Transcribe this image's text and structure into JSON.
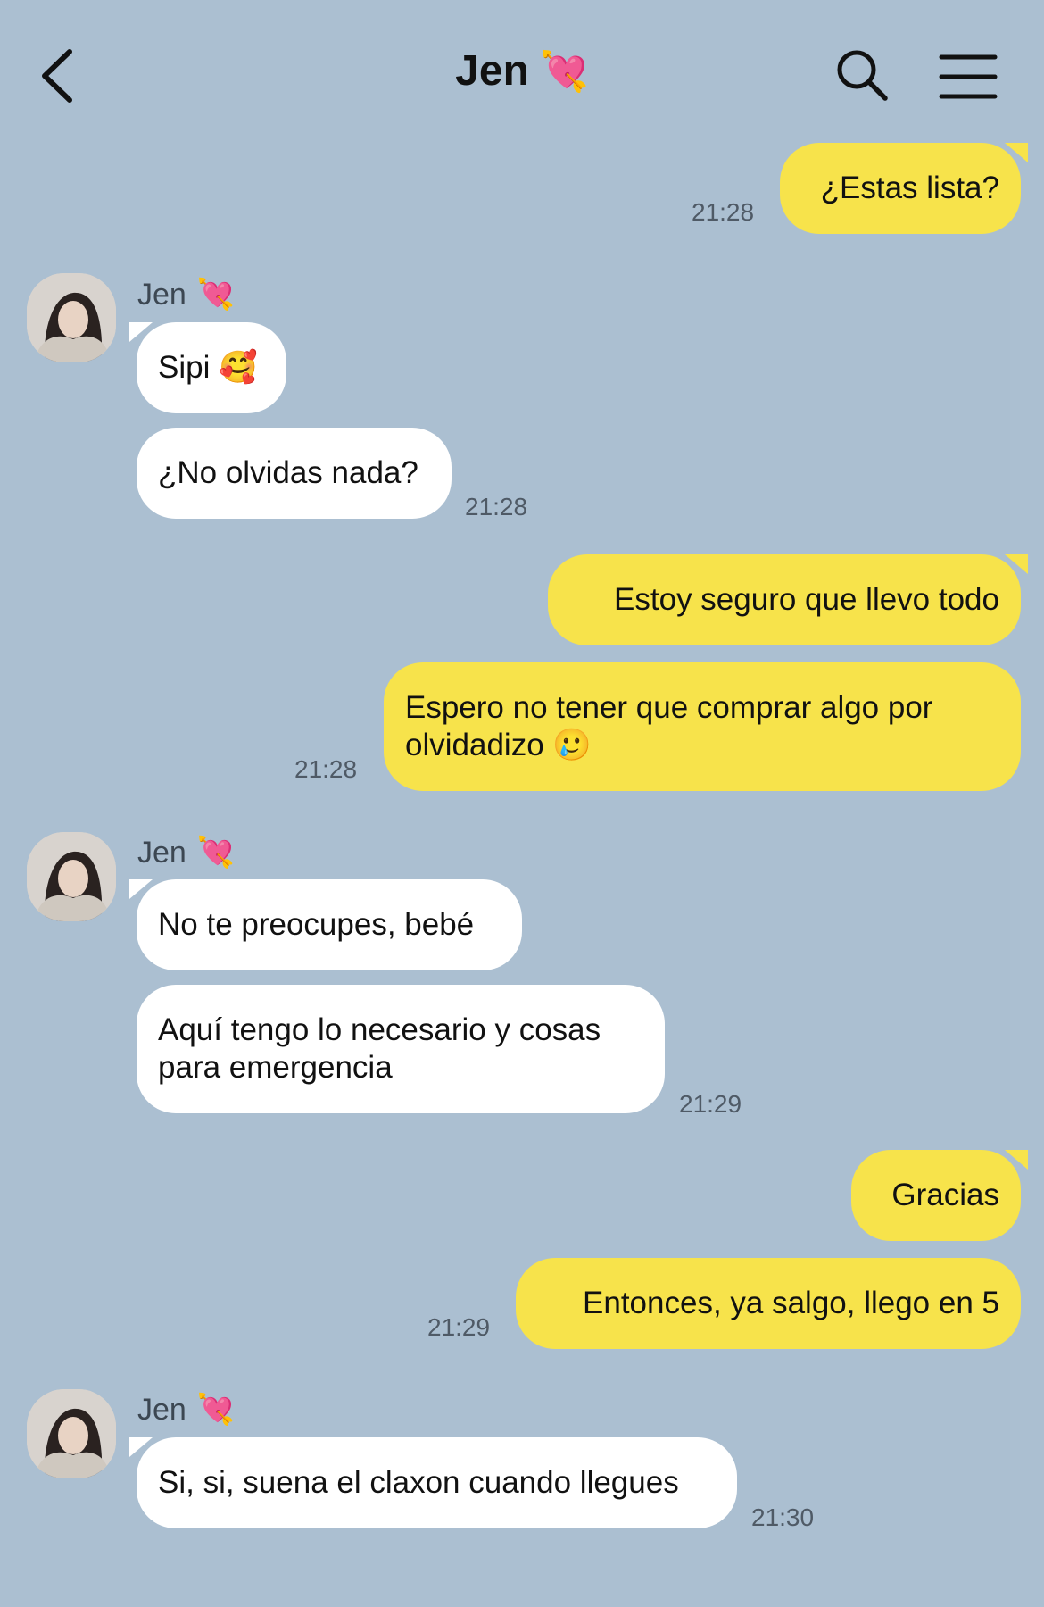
{
  "header": {
    "title": "Jen",
    "title_emoji": "💘",
    "back_icon": "chevron-left-icon",
    "search_icon": "search-icon",
    "menu_icon": "hamburger-menu-icon"
  },
  "colors": {
    "background": "#abbfd1",
    "my_bubble": "#f7e34b",
    "their_bubble": "#ffffff"
  },
  "sender": {
    "name": "Jen",
    "emoji": "💘"
  },
  "messages": [
    {
      "from": "me",
      "text": "¿Estas lista?",
      "time": "21:28"
    },
    {
      "from": "them",
      "text": "Sipi 🥰",
      "time": ""
    },
    {
      "from": "them",
      "text": "¿No olvidas nada?",
      "time": "21:28"
    },
    {
      "from": "me",
      "text": "Estoy seguro que llevo todo",
      "time": ""
    },
    {
      "from": "me",
      "text": "Espero no tener que comprar algo por olvidadizo 🥲",
      "time": "21:28"
    },
    {
      "from": "them",
      "text": "No te preocupes, bebé",
      "time": ""
    },
    {
      "from": "them",
      "text": "Aquí tengo lo necesario y cosas para emergencia",
      "time": "21:29"
    },
    {
      "from": "me",
      "text": "Gracias",
      "time": ""
    },
    {
      "from": "me",
      "text": "Entonces, ya salgo, llego en 5",
      "time": "21:29"
    },
    {
      "from": "them",
      "text": "Si, si, suena el claxon cuando llegues",
      "time": "21:30"
    }
  ]
}
